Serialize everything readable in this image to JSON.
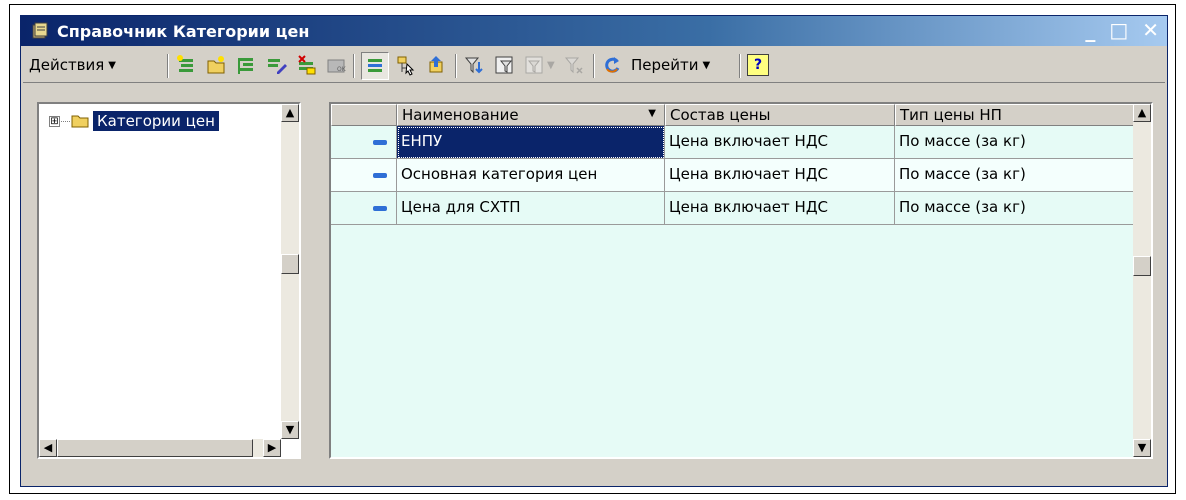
{
  "window": {
    "title": "Справочник Категории цен",
    "controls": {
      "minimize": "_",
      "maximize": "□",
      "close": "✕"
    }
  },
  "toolbar": {
    "actions_label": "Действия",
    "goto_label": "Перейти",
    "help_label": "?",
    "icons": [
      "add-item-icon",
      "add-folder-icon",
      "copy-item-icon",
      "edit-item-icon",
      "delete-mark-icon",
      "post-icon",
      "hierarchy-toggle-icon",
      "tree-view-icon",
      "level-up-icon",
      "filter-icon",
      "filter-by-value-icon",
      "filter-history-icon",
      "clear-filter-icon",
      "refresh-icon"
    ]
  },
  "tree": {
    "root_label": "Категории цен",
    "expander": "⊞"
  },
  "grid": {
    "columns": [
      "Наименование",
      "Состав цены",
      "Тип цены НП"
    ],
    "rows": [
      {
        "name": "ЕНПУ",
        "price_composition": "Цена включает НДС",
        "price_type": "По массе (за кг)"
      },
      {
        "name": "Основная категория цен",
        "price_composition": "Цена включает НДС",
        "price_type": "По массе (за кг)"
      },
      {
        "name": "Цена для СХТП",
        "price_composition": "Цена включает НДС",
        "price_type": "По массе (за кг)"
      }
    ],
    "selected_row": 0,
    "row_colors": [
      "#e6fbf6",
      "#f4fffd",
      "#e6fbf6"
    ]
  }
}
